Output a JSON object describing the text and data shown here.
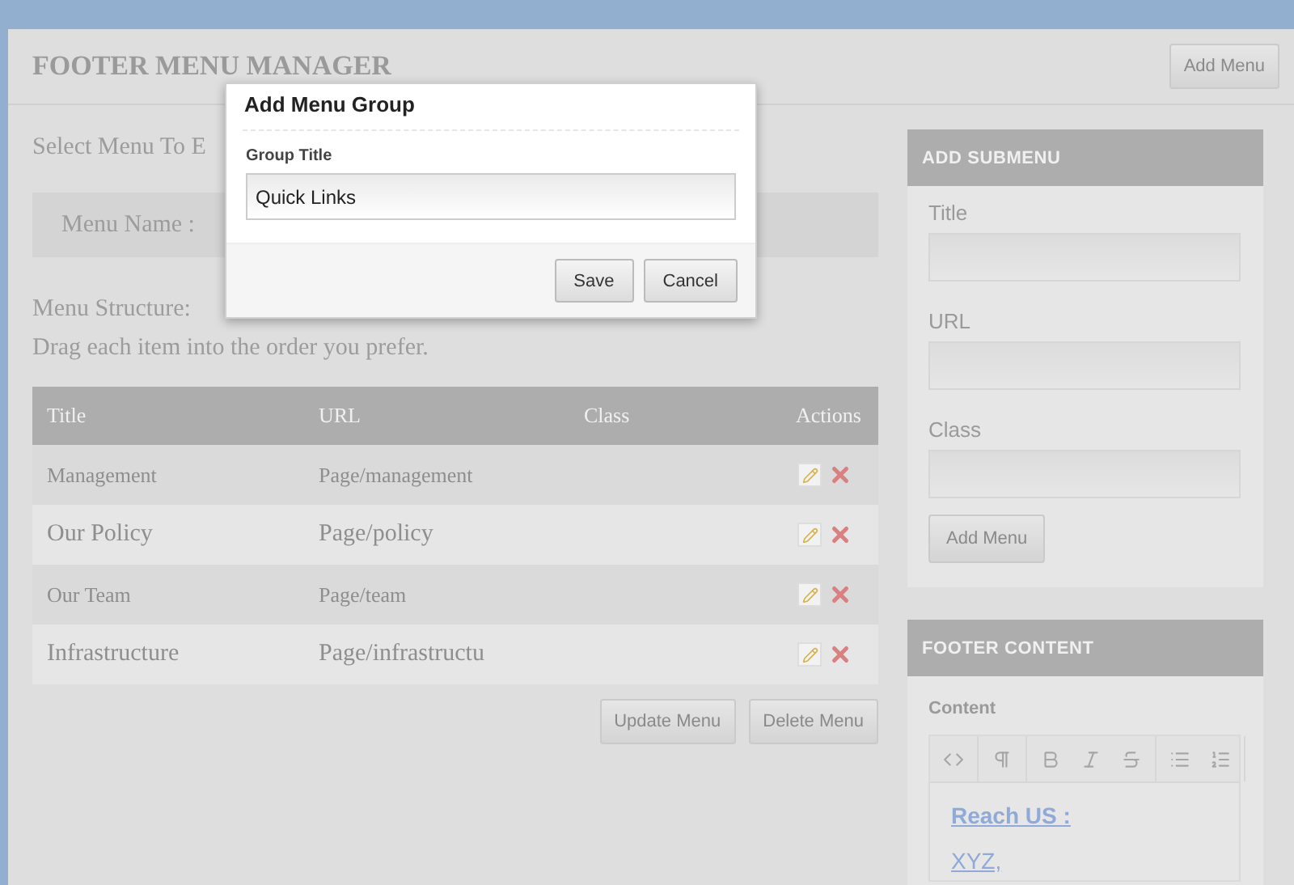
{
  "header": {
    "title": "FOOTER MENU MANAGER",
    "button": "Add Menu"
  },
  "left": {
    "select_label": "Select Menu To E",
    "menu_name_label": "Menu Name :",
    "structure_label": "Menu Structure:",
    "structure_hint": "Drag each item into the order you prefer."
  },
  "table": {
    "columns": [
      "Title",
      "URL",
      "Class",
      "Actions"
    ],
    "rows": [
      {
        "title": "Management",
        "url": "Page/management"
      },
      {
        "title": "Our Policy",
        "url": "Page/policy"
      },
      {
        "title": "Our Team",
        "url": "Page/team"
      },
      {
        "title": "Infrastructure",
        "url": "Page/infrastructu"
      }
    ]
  },
  "table_buttons": [
    "Update Menu",
    "Delete Menu"
  ],
  "submenu_panel": {
    "title": "ADD SUBMENU",
    "fields": [
      {
        "label": "Title"
      },
      {
        "label": "URL"
      },
      {
        "label": "Class"
      }
    ],
    "button": "Add Menu"
  },
  "footer_panel": {
    "title": "FOOTER CONTENT",
    "label": "Content",
    "lines": [
      {
        "kind": "heading",
        "text": "Reach US :"
      },
      {
        "kind": "link",
        "text": "XYZ,"
      }
    ]
  },
  "dialog": {
    "title": "Add Menu Group",
    "field_label": "Group Title",
    "value": "Quick Links",
    "buttons": [
      "Save",
      "Cancel"
    ]
  }
}
